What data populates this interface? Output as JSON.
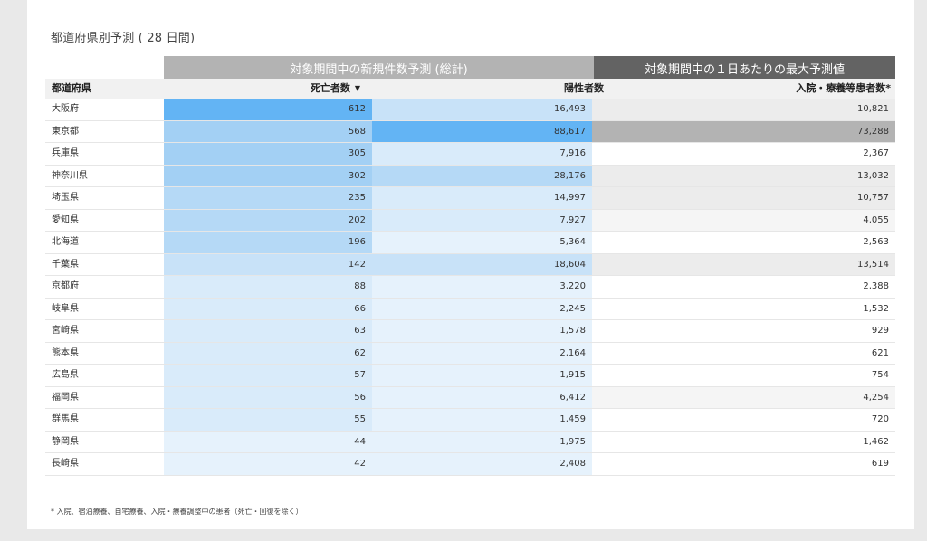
{
  "page_title": "都道府県別予測 ( 28 日間)",
  "group_headers": {
    "new_cases_total": "対象期間中の新規件数予測 (総計)",
    "daily_max": "対象期間中の１日あたりの最大予測値"
  },
  "columns": {
    "prefecture": "都道府県",
    "deaths": "死亡者数",
    "positives": "陽性者数",
    "inpatients": "入院・療養等患者数*"
  },
  "colors": {
    "blue_scale": [
      "#e6f2fc",
      "#d9ebfa",
      "#c8e2f8",
      "#b5d9f6",
      "#a3d0f4",
      "#63b4f4"
    ],
    "gray_scale": [
      "#ffffff",
      "#f5f5f5",
      "#ececec",
      "#b3b3b3"
    ],
    "group1_header": "#b3b3b3",
    "group2_header": "#636363"
  },
  "rows": [
    {
      "pref": "大阪府",
      "deaths": "612",
      "positives": "16,493",
      "inpatients": "10,821"
    },
    {
      "pref": "東京都",
      "deaths": "568",
      "positives": "88,617",
      "inpatients": "73,288"
    },
    {
      "pref": "兵庫県",
      "deaths": "305",
      "positives": "7,916",
      "inpatients": "2,367"
    },
    {
      "pref": "神奈川県",
      "deaths": "302",
      "positives": "28,176",
      "inpatients": "13,032"
    },
    {
      "pref": "埼玉県",
      "deaths": "235",
      "positives": "14,997",
      "inpatients": "10,757"
    },
    {
      "pref": "愛知県",
      "deaths": "202",
      "positives": "7,927",
      "inpatients": "4,055"
    },
    {
      "pref": "北海道",
      "deaths": "196",
      "positives": "5,364",
      "inpatients": "2,563"
    },
    {
      "pref": "千葉県",
      "deaths": "142",
      "positives": "18,604",
      "inpatients": "13,514"
    },
    {
      "pref": "京都府",
      "deaths": "88",
      "positives": "3,220",
      "inpatients": "2,388"
    },
    {
      "pref": "岐阜県",
      "deaths": "66",
      "positives": "2,245",
      "inpatients": "1,532"
    },
    {
      "pref": "宮崎県",
      "deaths": "63",
      "positives": "1,578",
      "inpatients": "929"
    },
    {
      "pref": "熊本県",
      "deaths": "62",
      "positives": "2,164",
      "inpatients": "621"
    },
    {
      "pref": "広島県",
      "deaths": "57",
      "positives": "1,915",
      "inpatients": "754"
    },
    {
      "pref": "福岡県",
      "deaths": "56",
      "positives": "6,412",
      "inpatients": "4,254"
    },
    {
      "pref": "群馬県",
      "deaths": "55",
      "positives": "1,459",
      "inpatients": "720"
    },
    {
      "pref": "静岡県",
      "deaths": "44",
      "positives": "1,975",
      "inpatients": "1,462"
    },
    {
      "pref": "長崎県",
      "deaths": "42",
      "positives": "2,408",
      "inpatients": "619"
    }
  ],
  "footnote": "* 入院、宿泊療養、自宅療養、入院・療養調整中の患者（死亡・回復を除く）"
}
